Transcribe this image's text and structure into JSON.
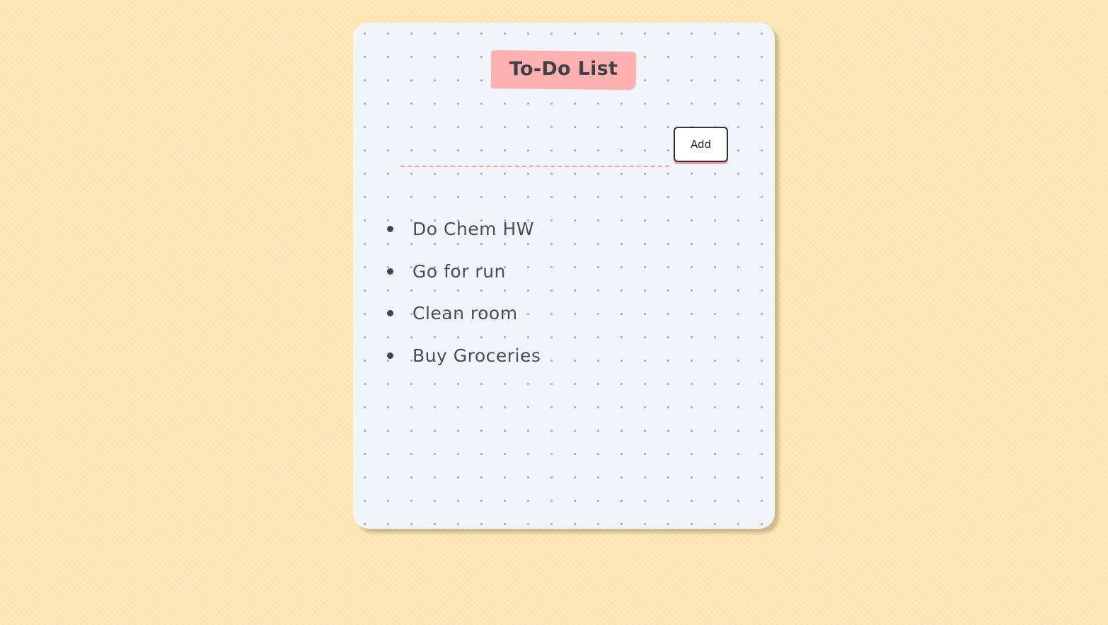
{
  "app": {
    "title": "To-Do List"
  },
  "input": {
    "value": "",
    "placeholder": ""
  },
  "buttons": {
    "add_label": "Add"
  },
  "tasks": [
    "Do Chem HW",
    "Go for run",
    "Clean room",
    "Buy Groceries"
  ],
  "colors": {
    "page_background": "#fde6b3",
    "card_background": "#f1f4f9",
    "accent_pink": "#ffb1b1",
    "text_dark": "#4a4d52"
  }
}
